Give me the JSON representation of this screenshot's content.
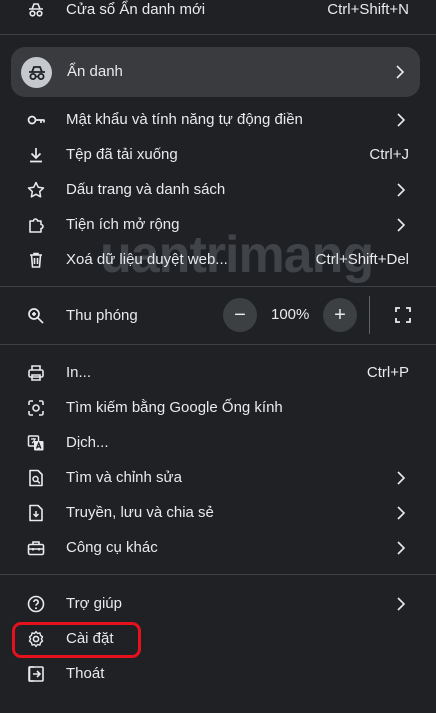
{
  "menu": {
    "new_incognito": {
      "label": "Cửa sổ Ẩn danh mới",
      "shortcut": "Ctrl+Shift+N"
    },
    "profile": {
      "label": "Ẩn danh"
    },
    "passwords": {
      "label": "Mật khẩu và tính năng tự động điền"
    },
    "downloads": {
      "label": "Tệp đã tải xuống",
      "shortcut": "Ctrl+J"
    },
    "bookmarks": {
      "label": "Dấu trang và danh sách"
    },
    "extensions": {
      "label": "Tiện ích mở rộng"
    },
    "clear_data": {
      "label": "Xoá dữ liệu duyệt web...",
      "shortcut": "Ctrl+Shift+Del"
    },
    "zoom": {
      "label": "Thu phóng",
      "minus": "−",
      "value": "100%",
      "plus": "+"
    },
    "print": {
      "label": "In...",
      "shortcut": "Ctrl+P"
    },
    "lens": {
      "label": "Tìm kiếm bằng Google Ống kính"
    },
    "translate": {
      "label": "Dịch..."
    },
    "find_edit": {
      "label": "Tìm và chỉnh sửa"
    },
    "cast_save_share": {
      "label": "Truyền, lưu và chia sẻ"
    },
    "more_tools": {
      "label": "Công cụ khác"
    },
    "help": {
      "label": "Trợ giúp"
    },
    "settings": {
      "label": "Cài đặt"
    },
    "exit": {
      "label": "Thoát"
    }
  },
  "watermark": "uantrimang",
  "colors": {
    "background": "#202124",
    "highlight": "#e5121d",
    "profile_bg": "#3a3b3e"
  }
}
